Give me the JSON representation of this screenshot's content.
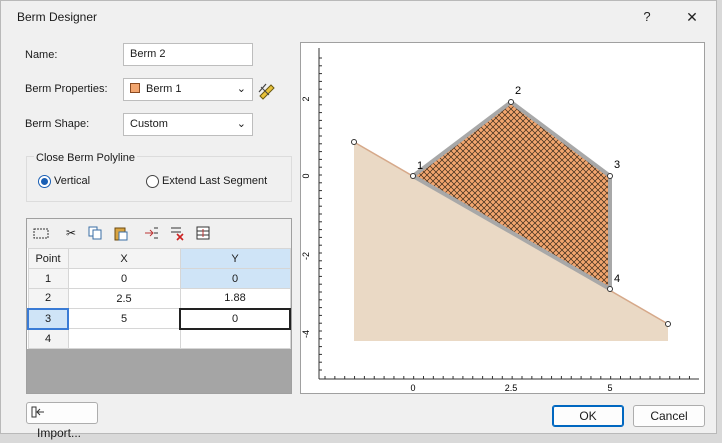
{
  "window": {
    "title": "Berm Designer",
    "help_glyph": "?",
    "close_glyph": "✕"
  },
  "form": {
    "name_label": "Name:",
    "name_value": "Berm 2",
    "props_label": "Berm Properties:",
    "props_value": "Berm 1",
    "props_color": "#f2a56e",
    "shape_label": "Berm Shape:",
    "shape_value": "Custom"
  },
  "close_polyline": {
    "title": "Close Berm Polyline",
    "option_vertical": "Vertical",
    "option_extend": "Extend Last Segment",
    "selected": "Vertical"
  },
  "grid": {
    "headers": [
      "Point",
      "X",
      "Y"
    ],
    "rows": [
      {
        "point": "1",
        "x": "0",
        "y": "0"
      },
      {
        "point": "2",
        "x": "2.5",
        "y": "1.88"
      },
      {
        "point": "3",
        "x": "5",
        "y": "0"
      },
      {
        "point": "4",
        "x": "",
        "y": ""
      }
    ]
  },
  "plot": {
    "x_ticks": [
      "0",
      "2.5",
      "5"
    ],
    "y_ticks": [
      "2",
      "0",
      "-2",
      "-4"
    ],
    "point_labels": [
      "1",
      "2",
      "3",
      "4"
    ],
    "colors": {
      "slope": "#ead9c5",
      "berm": "#f2a56e",
      "hatch": "#3a2a1a",
      "outline": "#a8a8a8"
    }
  },
  "buttons": {
    "import": "Import...",
    "ok": "OK",
    "cancel": "Cancel"
  }
}
